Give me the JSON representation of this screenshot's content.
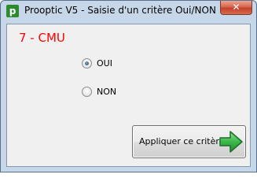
{
  "window": {
    "title": "Prooptic V5 - Saisie d'un critère Oui/NON",
    "app_icon_letter": "p",
    "app_icon": "prooptic-app-icon",
    "close_glyph": "✕"
  },
  "criterion": {
    "title": "7 - CMU",
    "title_color": "#ff0000"
  },
  "options": {
    "oui": {
      "label": "OUI",
      "selected": true
    },
    "non": {
      "label": "NON",
      "selected": false
    }
  },
  "apply_button": {
    "label": "Appliquer ce critère",
    "icon": "green-arrow-right-icon",
    "icon_color": "#2fa84f"
  }
}
